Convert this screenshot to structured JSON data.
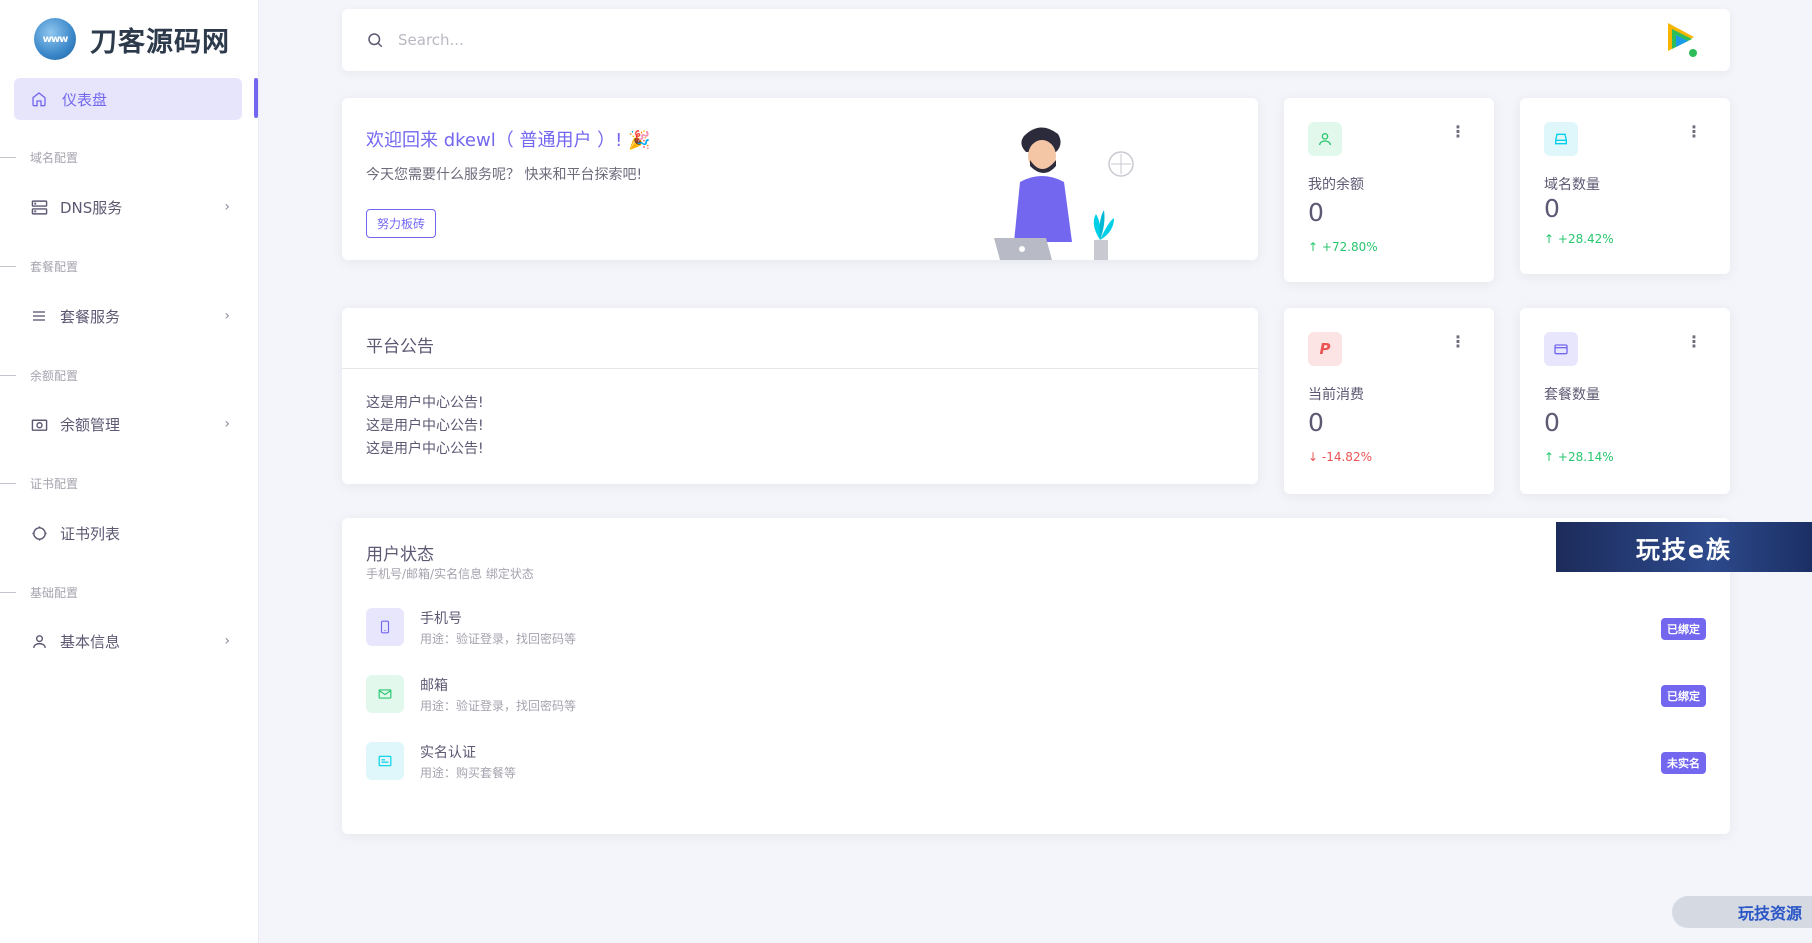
{
  "brand": {
    "name": "刀客源码网",
    "logo_text": "www"
  },
  "sidebar": {
    "active": {
      "label": "仪表盘",
      "icon": "home-icon"
    },
    "sections": [
      {
        "title": "域名配置",
        "item": {
          "label": "DNS服务",
          "icon": "server-icon",
          "has_submenu": true
        }
      },
      {
        "title": "套餐配置",
        "item": {
          "label": "套餐服务",
          "icon": "menu-icon",
          "has_submenu": true
        }
      },
      {
        "title": "余额配置",
        "item": {
          "label": "余额管理",
          "icon": "camera-icon",
          "has_submenu": true
        }
      },
      {
        "title": "证书配置",
        "item": {
          "label": "证书列表",
          "icon": "circle-icon",
          "has_submenu": false
        }
      },
      {
        "title": "基础配置",
        "item": {
          "label": "基本信息",
          "icon": "user-icon",
          "has_submenu": true
        }
      }
    ]
  },
  "search": {
    "placeholder": "Search..."
  },
  "welcome": {
    "title": "欢迎回来 dkewl（ 普通用户 ）! 🎉",
    "subtitle": "今天您需要什么服务呢？ 快来和平台探索吧!",
    "button": "努力板砖"
  },
  "stats": [
    {
      "label": "我的余额",
      "value": "0",
      "change": "+72.80%",
      "direction": "up",
      "icon": "user-icon",
      "color": "#28c76f"
    },
    {
      "label": "域名数量",
      "value": "0",
      "change": "+28.42%",
      "direction": "up",
      "icon": "hard-drive-icon",
      "color": "#00cfe8"
    },
    {
      "label": "当前消费",
      "value": "0",
      "change": "-14.82%",
      "direction": "down",
      "icon": "paypal-icon",
      "color": "#ea5455"
    },
    {
      "label": "套餐数量",
      "value": "0",
      "change": "+28.14%",
      "direction": "up",
      "icon": "wallet-icon",
      "color": "#7367f0"
    }
  ],
  "notice": {
    "title": "平台公告",
    "lines": [
      "这是用户中心公告!",
      "这是用户中心公告!",
      "这是用户中心公告!"
    ]
  },
  "user_status": {
    "title": "用户状态",
    "subtitle": "手机号/邮箱/实名信息 绑定状态",
    "rows": [
      {
        "name": "手机号",
        "desc": "用途：验证登录，找回密码等",
        "badge": "已绑定",
        "icon": "phone-icon",
        "color": "#7367f0"
      },
      {
        "name": "邮箱",
        "desc": "用途：验证登录，找回密码等",
        "badge": "已绑定",
        "icon": "mail-icon",
        "color": "#28c76f"
      },
      {
        "name": "实名认证",
        "desc": "用途：购买套餐等",
        "badge": "未实名",
        "icon": "id-card-icon",
        "color": "#00cfe8"
      }
    ]
  },
  "watermarks": {
    "banner": "玩技e族",
    "corner": "玩技资源"
  }
}
